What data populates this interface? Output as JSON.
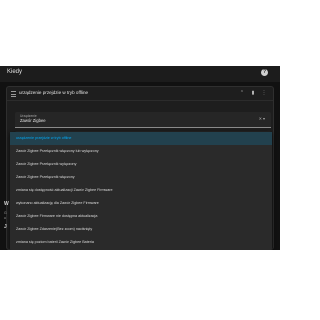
{
  "appbar": {
    "title": "Kiedy",
    "help_icon": "help-circle-icon"
  },
  "trigger_card": {
    "title": "urządzenie przejdzie w tryb offline",
    "header_icons": [
      "drag-handle-icon",
      "expand-less-icon",
      "more-vertical-icon"
    ]
  },
  "device_field": {
    "label": "Urządzenie",
    "value": "Zawór Zigbee",
    "icons": [
      "clear-icon",
      "dropdown-icon"
    ]
  },
  "trigger_field": {
    "label": "Wyzwalacz",
    "value": "urządzenie przejdzie w tryb offline",
    "icon": "dropdown-icon"
  },
  "menu": {
    "items": [
      "urządzenie przejdzie w tryb offline",
      "Zawór Zigbee Przełącznik włączony lub wyłączony",
      "Zawór Zigbee Przełącznik wyłączony",
      "Zawór Zigbee Przełącznik włączony",
      "zmiana się dostępność aktualizacji Zawór Zigbee Firmware",
      "wykonano aktualizację dla Zawór Zigbee Firmware",
      "Zawór Zigbee Firmware nie dostępna aktualizacja",
      "Zawór Zigbee Zdarzenie(Bez zoom) naciśnięty",
      "zmiana się poziom baterii Zawór Zigbee Bateria"
    ],
    "selected_index": 0
  },
  "background_peek": {
    "j": "J",
    "w": "W",
    "g": "G\nu"
  },
  "colors": {
    "accent": "#03a9f4",
    "surface": "#1e1e1e",
    "background": "#111111"
  }
}
